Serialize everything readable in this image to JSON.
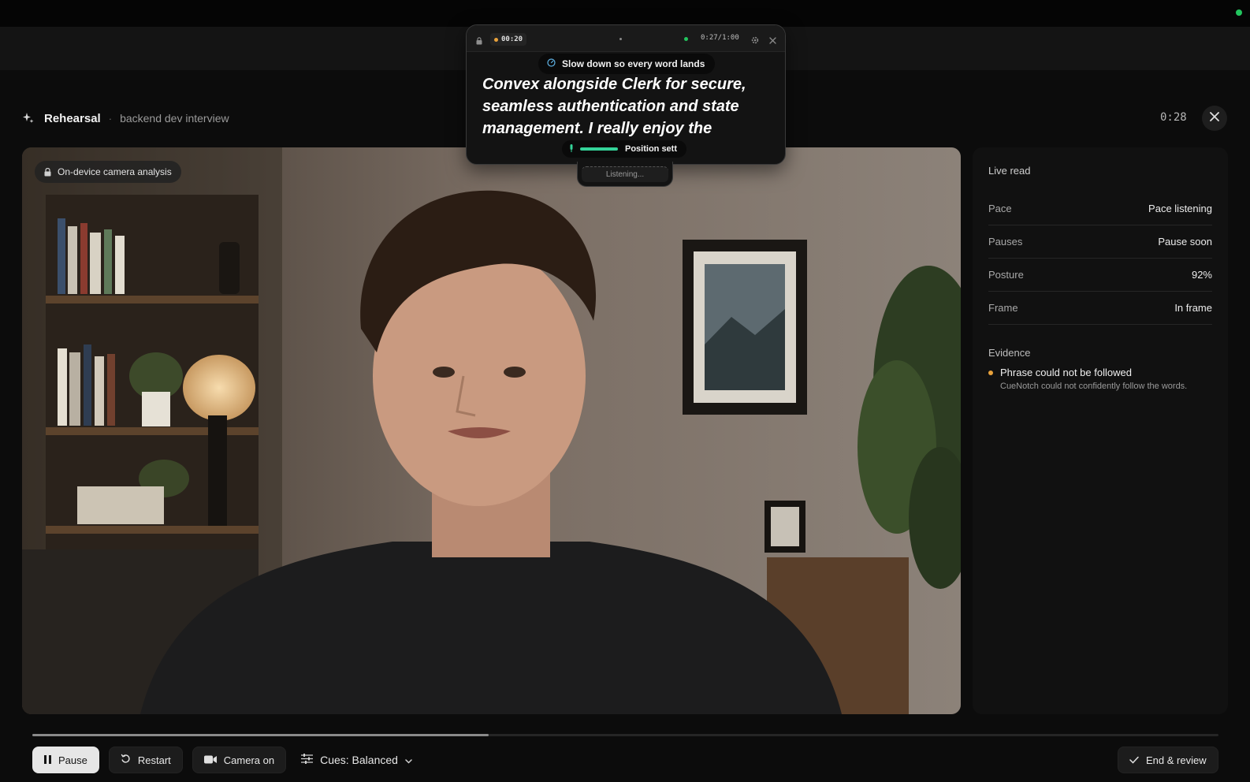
{
  "header": {
    "title": "Rehearsal",
    "separator": "·",
    "subtitle": "backend dev interview",
    "timer": "0:28"
  },
  "camera": {
    "badge_label": "On-device camera analysis"
  },
  "overlay": {
    "rec_time": "00:20",
    "counter": "0:27/1:00",
    "cue": "Slow down so every word lands",
    "script_text": "Convex alongside Clerk for secure, seamless authentication and state management. I really enjoy the",
    "position_label": "Position sett",
    "listening_label": "Listening..."
  },
  "live_read": {
    "title": "Live read",
    "metrics": [
      {
        "label": "Pace",
        "value": "Pace listening"
      },
      {
        "label": "Pauses",
        "value": "Pause soon"
      },
      {
        "label": "Posture",
        "value": "92%"
      },
      {
        "label": "Frame",
        "value": "In frame"
      }
    ]
  },
  "evidence": {
    "title": "Evidence",
    "items": [
      {
        "headline": "Phrase could not be followed",
        "detail": "CueNotch could not confidently follow the words."
      }
    ]
  },
  "progress": {
    "fraction": 0.385
  },
  "controls": {
    "pause_label": "Pause",
    "restart_label": "Restart",
    "camera_label": "Camera on",
    "cues_label": "Cues: Balanced",
    "end_label": "End & review"
  },
  "colors": {
    "accent_green": "#22c55e",
    "warning_amber": "#e9a23b",
    "position_bar": "#34d399"
  }
}
